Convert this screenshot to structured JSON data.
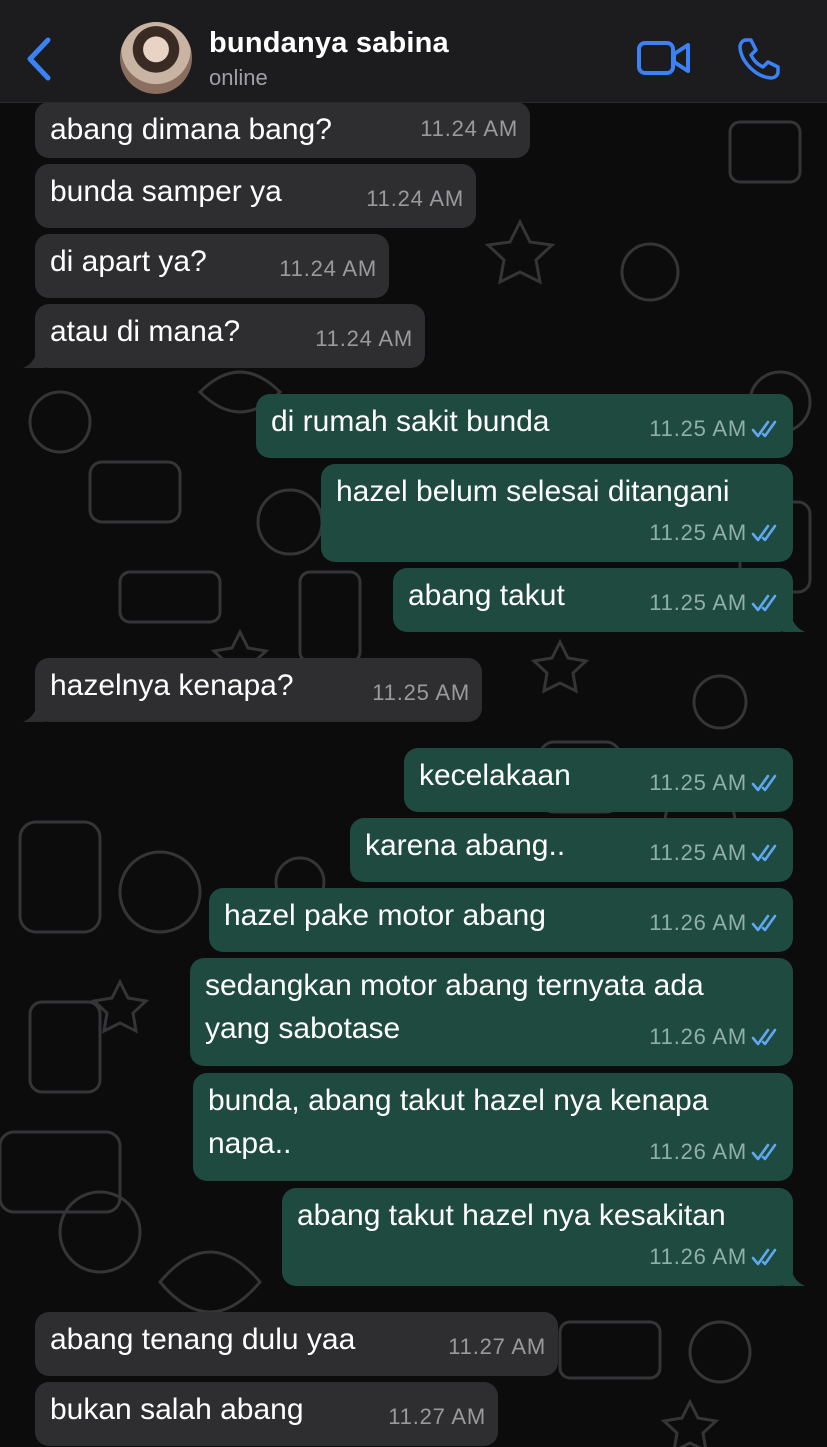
{
  "contact": {
    "name": "bundanya sabina",
    "status": "online"
  },
  "icons": {
    "back": "chevron-left-icon",
    "video": "video-camera-icon",
    "call": "phone-icon",
    "read": "double-check-icon"
  },
  "colors": {
    "accent": "#3b82f6",
    "incoming": "#2e2e30",
    "outgoing": "#1f4a3f",
    "read_ticks": "#5ea8f0"
  },
  "messages": [
    {
      "dir": "in",
      "text": "abang dimana bang?",
      "time": "11.24 AM"
    },
    {
      "dir": "in",
      "text": "bunda samper ya",
      "time": "11.24 AM"
    },
    {
      "dir": "in",
      "text": "di apart ya?",
      "time": "11.24 AM"
    },
    {
      "dir": "in",
      "text": "atau di mana?",
      "time": "11.24 AM"
    },
    {
      "dir": "out",
      "text": "di rumah sakit bunda",
      "time": "11.25 AM"
    },
    {
      "dir": "out",
      "text": "hazel belum selesai ditangani",
      "time": "11.25 AM"
    },
    {
      "dir": "out",
      "text": "abang takut",
      "time": "11.25 AM"
    },
    {
      "dir": "in",
      "text": "hazelnya kenapa?",
      "time": "11.25 AM"
    },
    {
      "dir": "out",
      "text": "kecelakaan",
      "time": "11.25 AM"
    },
    {
      "dir": "out",
      "text": "karena abang..",
      "time": "11.25 AM"
    },
    {
      "dir": "out",
      "text": "hazel pake motor abang",
      "time": "11.26 AM"
    },
    {
      "dir": "out",
      "text": "sedangkan motor abang ternyata ada",
      "text2": "yang sabotase",
      "time": "11.26 AM"
    },
    {
      "dir": "out",
      "text": "bunda, abang takut hazel nya kenapa",
      "text2": "napa..",
      "time": "11.26 AM"
    },
    {
      "dir": "out",
      "text": "abang takut hazel nya kesakitan",
      "time": "11.26 AM"
    },
    {
      "dir": "in",
      "text": "abang tenang dulu yaa",
      "time": "11.27 AM"
    },
    {
      "dir": "in",
      "text": "bukan salah abang",
      "time": "11.27 AM"
    }
  ]
}
